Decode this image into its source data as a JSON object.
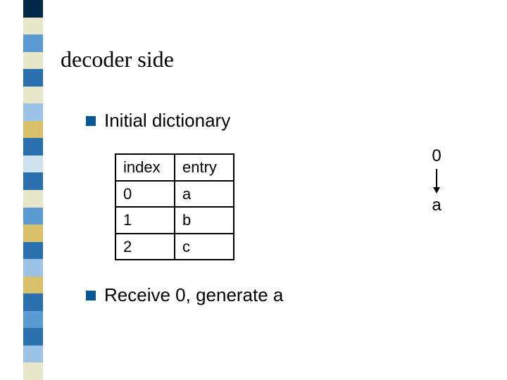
{
  "deco_colors": [
    "#012a4a",
    "#e8e7c9",
    "#5a9bd4",
    "#e8e7c9",
    "#2a6fae",
    "#e8e7c9",
    "#9cc3e6",
    "#d9c16b",
    "#2a6fae",
    "#cfe2f0",
    "#2a6fae",
    "#e8e7c9",
    "#5a9bd4",
    "#d9c16b",
    "#2a6fae",
    "#9cc3e6",
    "#d9c16b",
    "#2a6fae",
    "#5a9bd4",
    "#2a6fae",
    "#9cc3e6",
    "#e8e7c9"
  ],
  "title": "decoder side",
  "bullets": {
    "item1": "Initial dictionary",
    "item2": "Receive  0, generate  a"
  },
  "table": {
    "header": {
      "c0": "index",
      "c1": "entry"
    },
    "rows": [
      {
        "c0": "0",
        "c1": "a"
      },
      {
        "c0": "1",
        "c1": "b"
      },
      {
        "c0": "2",
        "c1": "c"
      }
    ]
  },
  "annotation": {
    "top": "0",
    "bottom": "a"
  }
}
